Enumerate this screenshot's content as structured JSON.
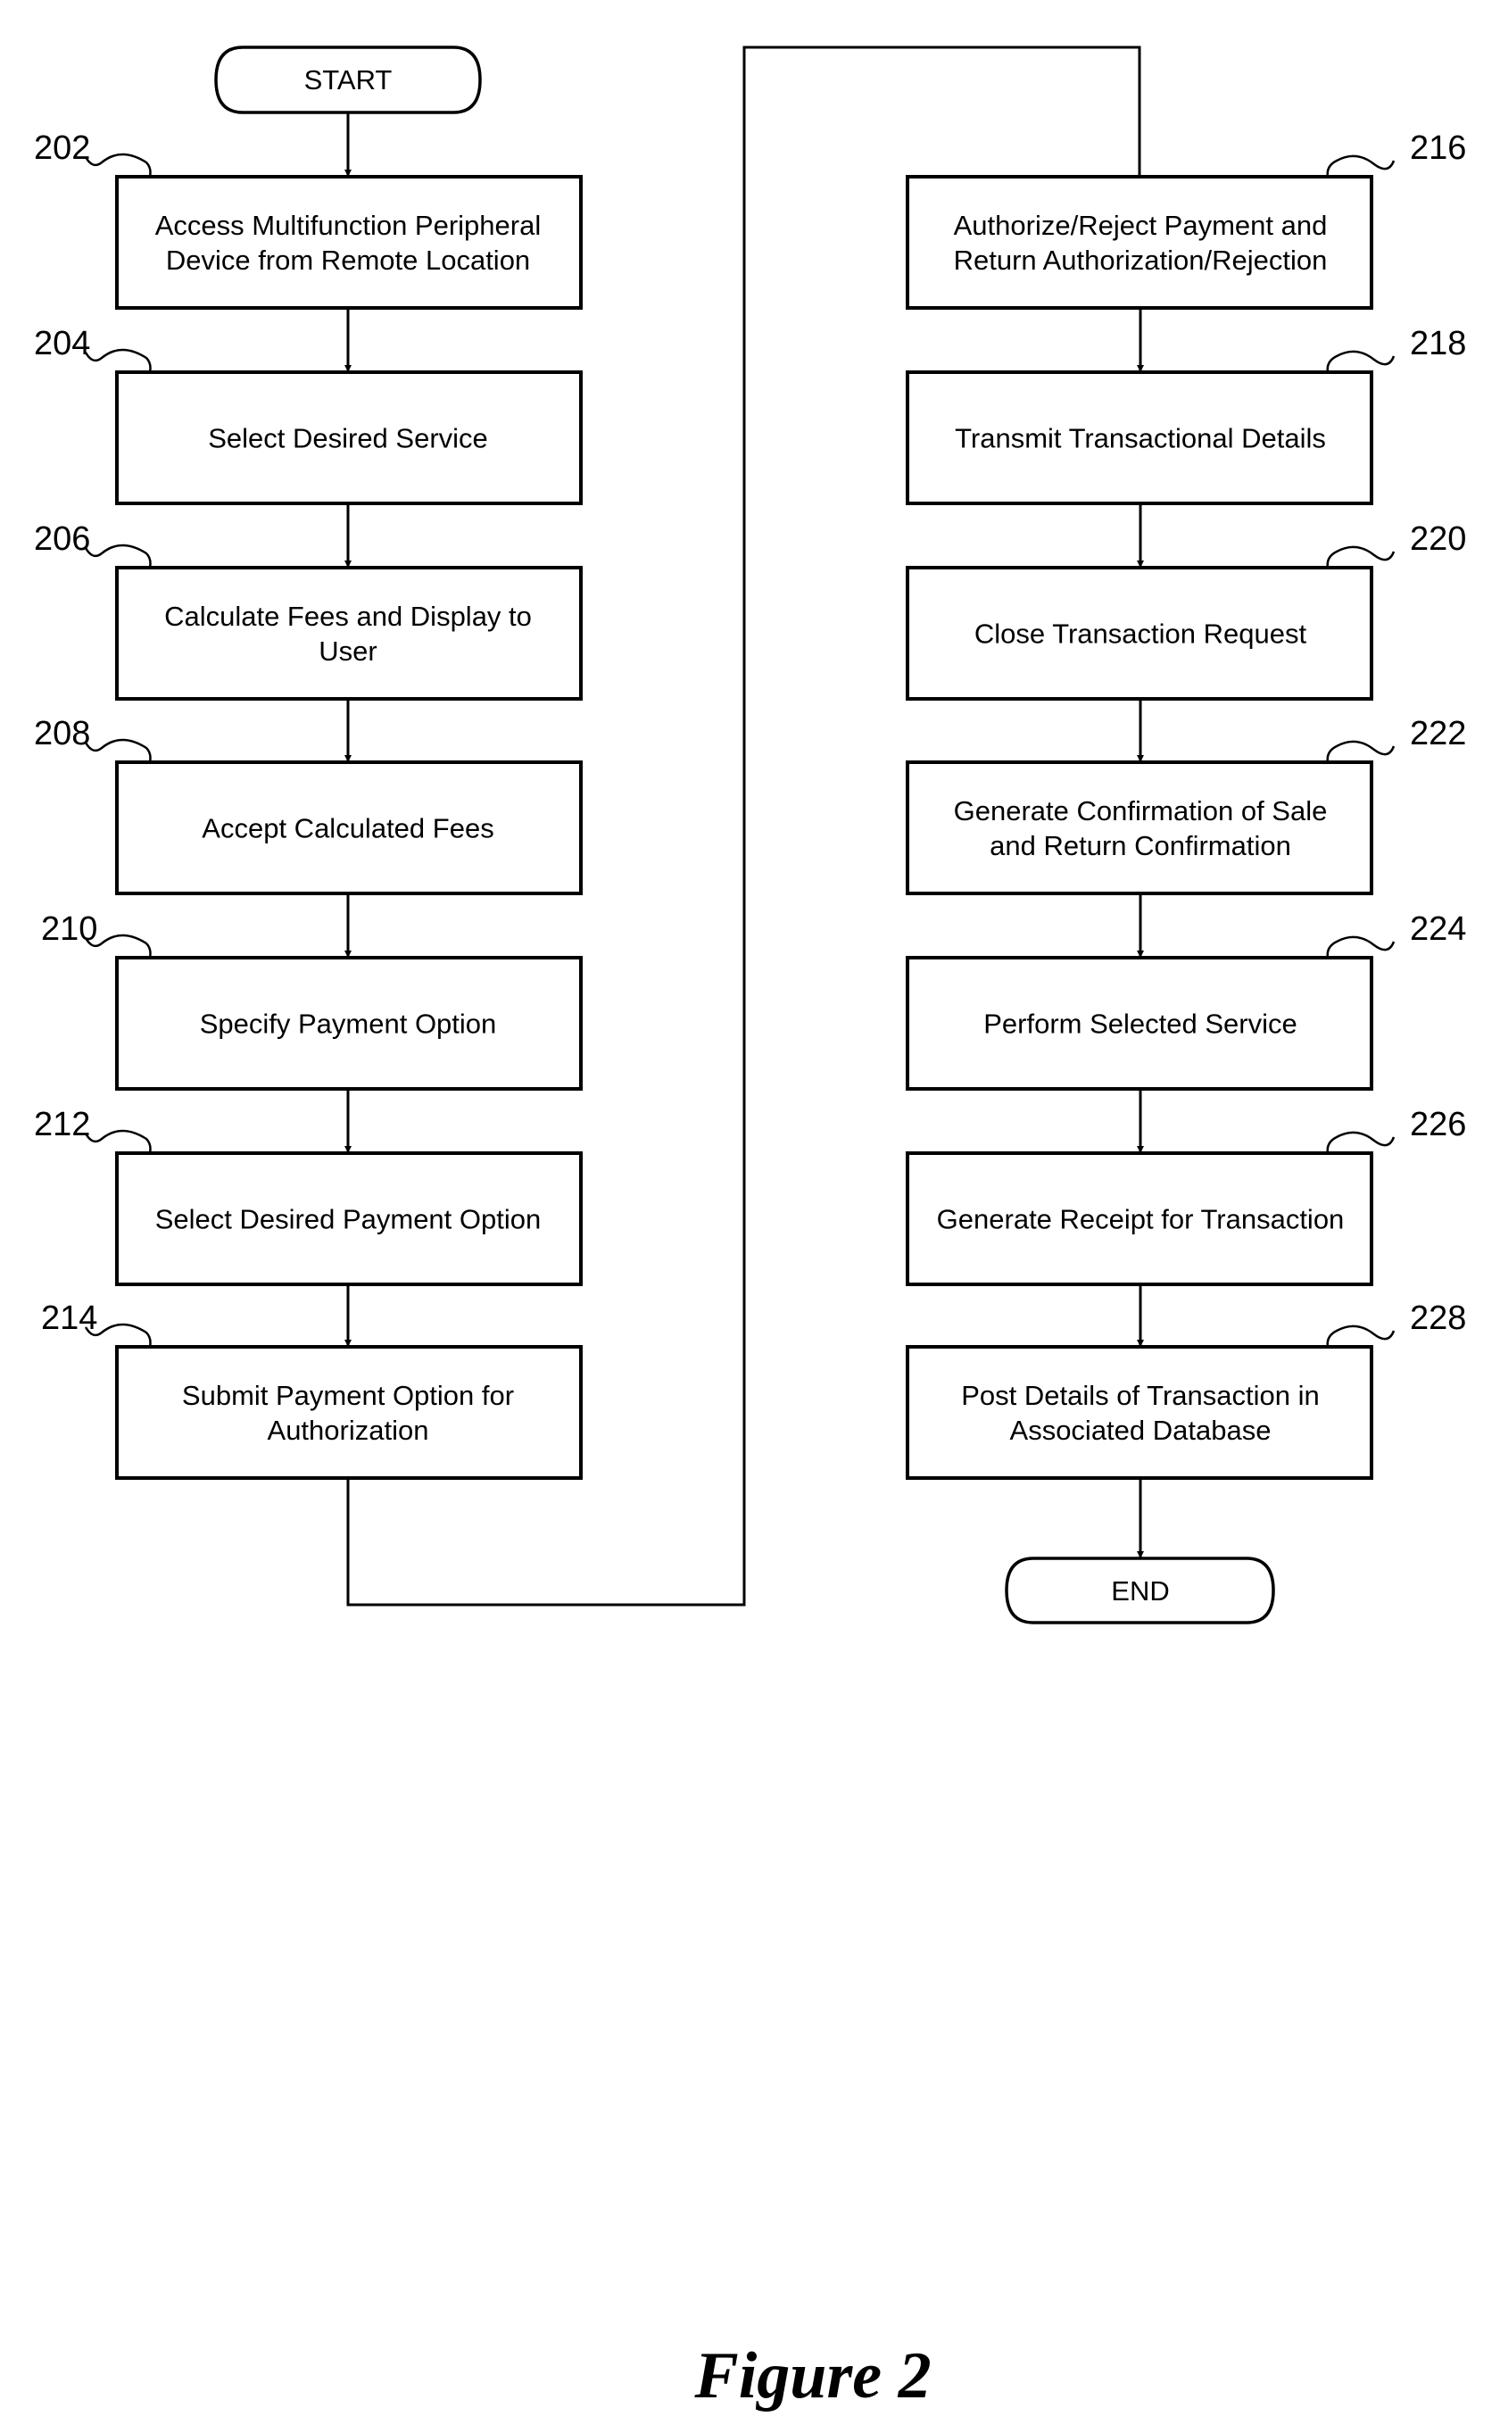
{
  "figure": {
    "caption": "Figure 2",
    "start_label": "START",
    "end_label": "END",
    "steps": [
      {
        "ref": "202",
        "lines": [
          "Access Multifunction Peripheral",
          "Device from Remote Location"
        ]
      },
      {
        "ref": "204",
        "lines": [
          "Select Desired Service"
        ]
      },
      {
        "ref": "206",
        "lines": [
          "Calculate Fees and Display to",
          "User"
        ]
      },
      {
        "ref": "208",
        "lines": [
          "Accept Calculated Fees"
        ]
      },
      {
        "ref": "210",
        "lines": [
          "Specify Payment Option"
        ]
      },
      {
        "ref": "212",
        "lines": [
          "Select Desired Payment Option"
        ]
      },
      {
        "ref": "214",
        "lines": [
          "Submit Payment Option for",
          "Authorization"
        ]
      },
      {
        "ref": "216",
        "lines": [
          "Authorize/Reject Payment and",
          "Return Authorization/Rejection"
        ]
      },
      {
        "ref": "218",
        "lines": [
          "Transmit Transactional Details"
        ]
      },
      {
        "ref": "220",
        "lines": [
          "Close Transaction Request"
        ]
      },
      {
        "ref": "222",
        "lines": [
          "Generate Confirmation of Sale",
          "and Return Confirmation"
        ]
      },
      {
        "ref": "224",
        "lines": [
          "Perform Selected Service"
        ]
      },
      {
        "ref": "226",
        "lines": [
          "Generate Receipt for Transaction"
        ]
      },
      {
        "ref": "228",
        "lines": [
          "Post Details of Transaction in",
          "Associated Database"
        ]
      }
    ]
  }
}
